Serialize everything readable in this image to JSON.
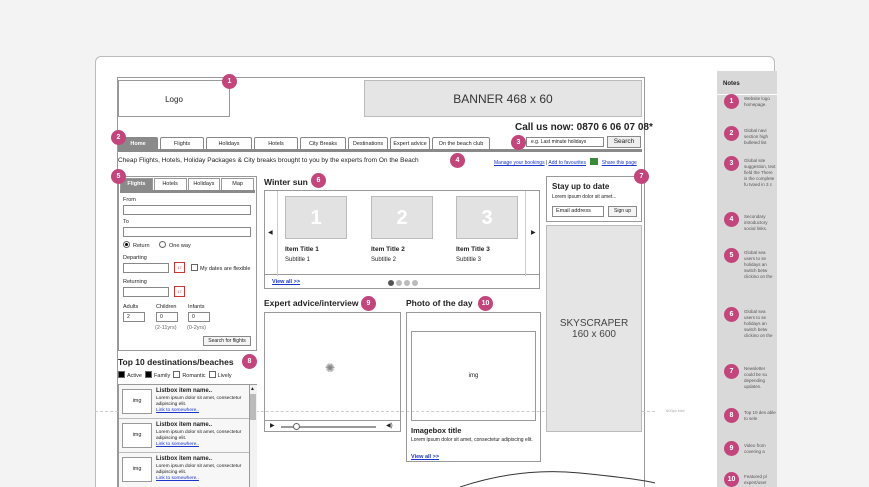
{
  "header": {
    "logo": "Logo",
    "banner": "BANNER 468 x 60",
    "call_us": "Call us now: 0870 6 06 07 08*",
    "search_placeholder": "e.g. Last minute holidays",
    "search_button": "Search"
  },
  "nav": {
    "tabs": [
      "Home",
      "Flights",
      "Holidays",
      "Hotels",
      "City Breaks",
      "Destinations",
      "Expert advice",
      "On the beach club"
    ]
  },
  "tagline": "Cheap Flights, Hotels, Holiday Packages & City breaks brought to you by the experts from On the Beach",
  "util": {
    "manage": "Manage your bookings",
    "sep": "|",
    "favourites": "Add to favourites",
    "share": "Share this page"
  },
  "search_panel": {
    "tabs": [
      "Flights",
      "Hotels",
      "Holidays",
      "Map"
    ],
    "from": "From",
    "to": "To",
    "return": "Return",
    "one_way": "One way",
    "departing": "Departing",
    "flexible": "My dates are flexible",
    "returning": "Returning",
    "adults": "Adults",
    "children": "Children",
    "infants": "Infants",
    "adults_val": "2",
    "children_val": "0",
    "infants_val": "0",
    "children_hint": "(2-11yrs)",
    "infants_hint": "(0-2yrs)",
    "button": "Search for flights"
  },
  "winter": {
    "title": "Winter sun",
    "items": [
      {
        "num": "1",
        "title": "Item Title 1",
        "subtitle": "Subtitle 1"
      },
      {
        "num": "2",
        "title": "Item Title 2",
        "subtitle": "Subtitle 2"
      },
      {
        "num": "3",
        "title": "Item Title 3",
        "subtitle": "Subtitle 3"
      }
    ],
    "view_all": "View all >>"
  },
  "newsletter": {
    "title": "Stay up to date",
    "text": "Lorem ipsum dolor sit amet...",
    "email": "Email address",
    "button": "Sign up"
  },
  "skyscraper": {
    "line1": "SKYSCRAPER",
    "line2": "160 x 600"
  },
  "expert": {
    "title": "Expert advice/interview"
  },
  "photo": {
    "title": "Photo of the day",
    "img": "img",
    "box_title": "Imagebox title",
    "text": "Lorem ipsum dolor sit amet, consectetur adipiscing elit.",
    "view_all": "View all >>"
  },
  "top10": {
    "title": "Top 10 destinations/beaches",
    "filters": [
      "Active",
      "Family",
      "Romantic",
      "Lively"
    ],
    "items": [
      {
        "img": "img",
        "title": "Listbox item name..",
        "desc": "Lorem ipsum dolor sit amet, consectetur adipiscing elit.",
        "link": "Link to somewhere.."
      },
      {
        "img": "img",
        "title": "Listbox item name..",
        "desc": "Lorem ipsum dolor sit amet, consectetur adipiscing elit.",
        "link": "Link to somewhere.."
      },
      {
        "img": "img",
        "title": "Listbox item name..",
        "desc": "Lorem ipsum dolor sit amet, consectetur adipiscing elit.",
        "link": "Link to somewhere.."
      }
    ]
  },
  "notes": {
    "title": "Notes",
    "items": [
      {
        "n": "1",
        "text": "Website logo homepage."
      },
      {
        "n": "2",
        "text": "Global navi section high bulleted list"
      },
      {
        "n": "3",
        "text": "Global site suggestion, text field the There is the complete fu typed in 3 c"
      },
      {
        "n": "4",
        "text": "Secondary introductory social links."
      },
      {
        "n": "5",
        "text": "Global sea users to se holidays an switch betw clicking on the relevant"
      },
      {
        "n": "6",
        "text": "Global sea users to se holidays an switch betw clicking on the relevant"
      },
      {
        "n": "7",
        "text": "Newsletter could be su depending updates."
      },
      {
        "n": "8",
        "text": "Top 10 des able to sele"
      },
      {
        "n": "9",
        "text": "Video from covering a"
      },
      {
        "n": "10",
        "text": "Featured pl expert/user"
      }
    ]
  },
  "fold_label": "600px fold",
  "markers": [
    "1",
    "2",
    "3",
    "4",
    "5",
    "6",
    "7",
    "8",
    "9",
    "10"
  ]
}
